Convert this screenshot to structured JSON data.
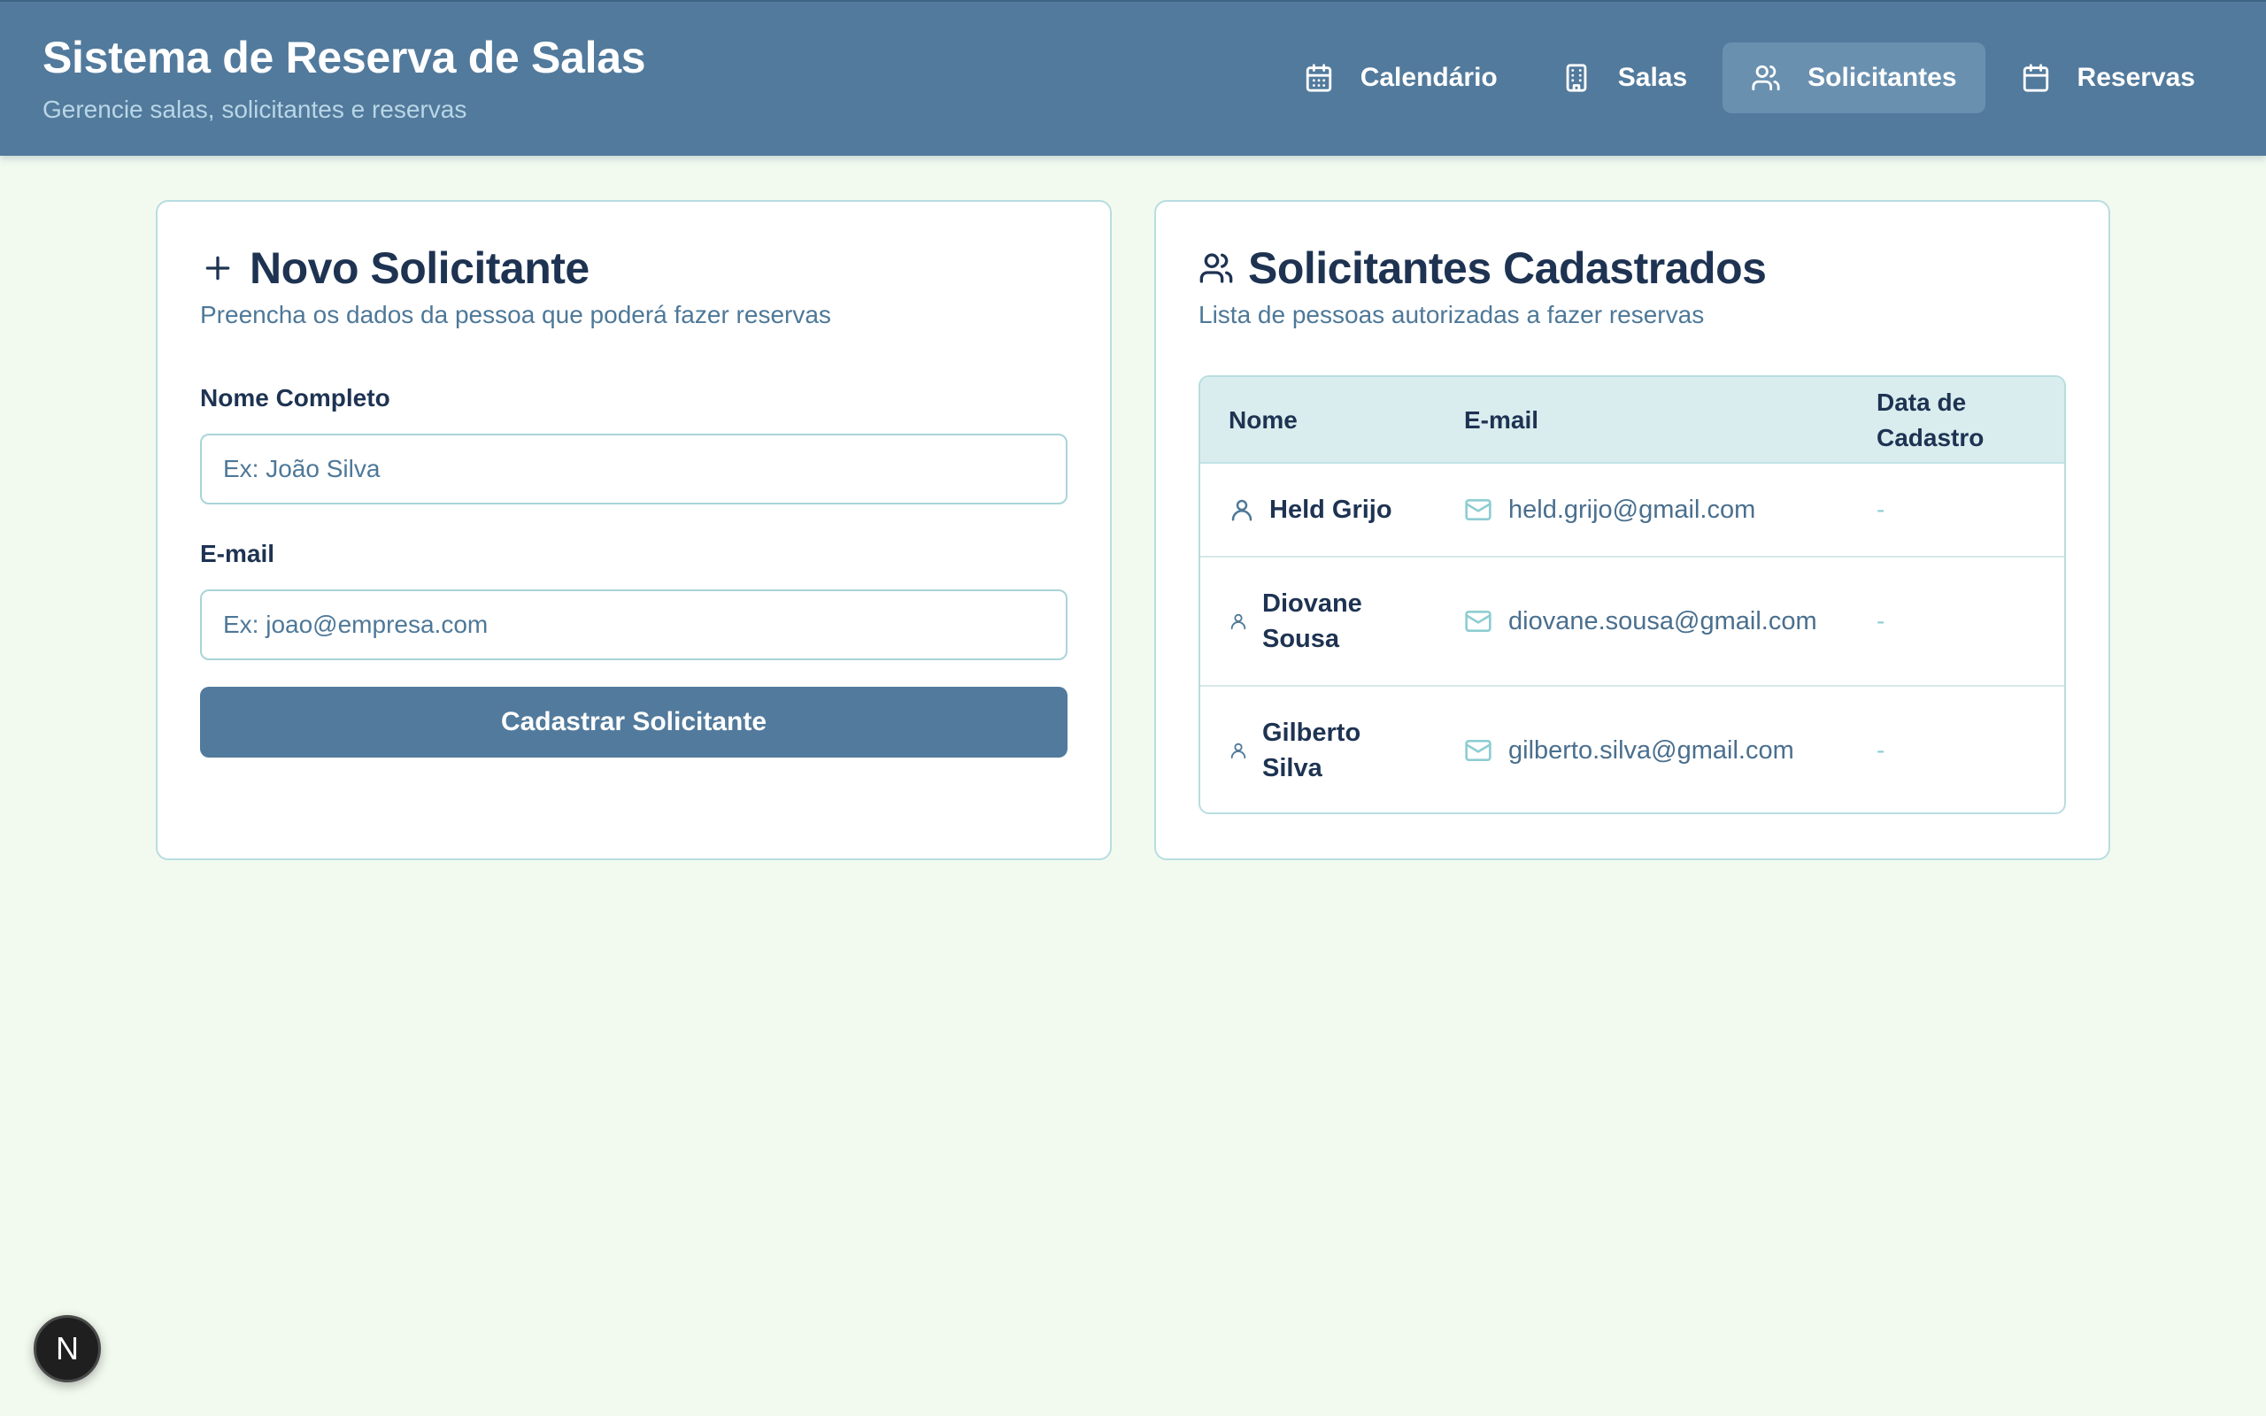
{
  "header": {
    "title": "Sistema de Reserva de Salas",
    "subtitle": "Gerencie salas, solicitantes e reservas"
  },
  "nav": {
    "items": [
      {
        "label": "Calendário",
        "icon": "calendar-icon"
      },
      {
        "label": "Salas",
        "icon": "building-icon"
      },
      {
        "label": "Solicitantes",
        "icon": "users-icon",
        "active": true
      },
      {
        "label": "Reservas",
        "icon": "calendar-icon"
      }
    ]
  },
  "form": {
    "title": "Novo Solicitante",
    "description": "Preencha os dados da pessoa que poderá fazer reservas",
    "name_label": "Nome Completo",
    "name_placeholder": "Ex: João Silva",
    "name_value": "",
    "email_label": "E-mail",
    "email_placeholder": "Ex: joao@empresa.com",
    "email_value": "",
    "submit_label": "Cadastrar Solicitante"
  },
  "list": {
    "title": "Solicitantes Cadastrados",
    "description": "Lista de pessoas autorizadas a fazer reservas",
    "columns": [
      "Nome",
      "E-mail",
      "Data de Cadastro"
    ],
    "rows": [
      {
        "name": "Held Grijo",
        "email": "held.grijo@gmail.com",
        "date": "-"
      },
      {
        "name": "Diovane Sousa",
        "email": "diovane.sousa@gmail.com",
        "date": "-"
      },
      {
        "name": "Gilberto Silva",
        "email": "gilberto.silva@gmail.com",
        "date": "-"
      }
    ]
  },
  "badge": {
    "label": "N"
  },
  "colors": {
    "header_bg": "#527a9c",
    "page_bg": "#f2faef",
    "accent_border": "#b8dde0",
    "table_head_bg": "#d9edee",
    "text_dark": "#1e3352",
    "text_muted": "#4e7898"
  }
}
